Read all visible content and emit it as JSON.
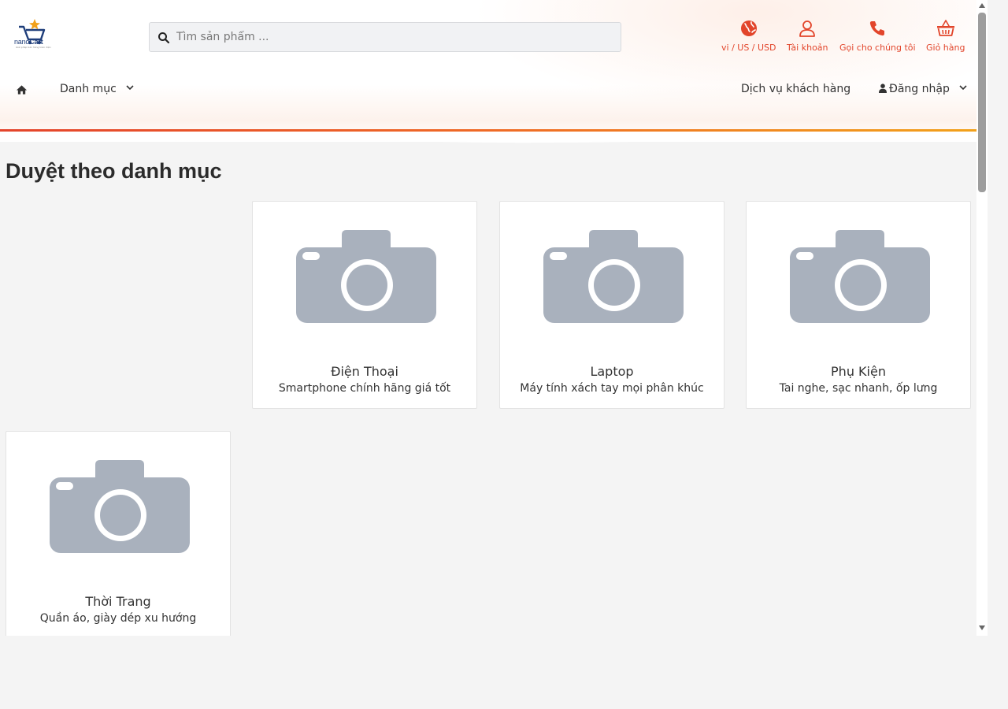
{
  "brand": {
    "name_part1": "nano",
    "name_part2": "Cart",
    "tagline": "Giải pháp bán hàng toàn diện"
  },
  "search": {
    "placeholder": "Tìm sản phẩm ..."
  },
  "top_actions": {
    "locale": {
      "label": "vi / US / USD",
      "icon": "globe-icon"
    },
    "account": {
      "label": "Tài khoản",
      "icon": "user-icon"
    },
    "call": {
      "label": "Gọi cho chúng tôi",
      "icon": "phone-icon"
    },
    "cart": {
      "label": "Giỏ hàng",
      "icon": "basket-icon"
    }
  },
  "nav": {
    "home_icon": "home-icon",
    "categories_label": "Danh mục",
    "customer_service_label": "Dịch vụ khách hàng",
    "login_label": "Đăng nhập"
  },
  "page": {
    "title": "Duyệt theo danh mục"
  },
  "categories": [
    {
      "title": "Điện Thoại",
      "description": "Smartphone chính hãng giá tốt",
      "icon": "camera-placeholder-icon"
    },
    {
      "title": "Laptop",
      "description": "Máy tính xách tay mọi phân khúc",
      "icon": "camera-placeholder-icon"
    },
    {
      "title": "Phụ Kiện",
      "description": "Tai nghe, sạc nhanh, ốp lưng",
      "icon": "camera-placeholder-icon"
    },
    {
      "title": "Thời Trang",
      "description": "Quần áo, giày dép xu hướng",
      "icon": "camera-placeholder-icon"
    }
  ],
  "colors": {
    "accent": "#e2452b",
    "accent_end": "#f2a11a",
    "placeholder_gray": "#a9b1bd",
    "background": "#f4f4f4"
  }
}
